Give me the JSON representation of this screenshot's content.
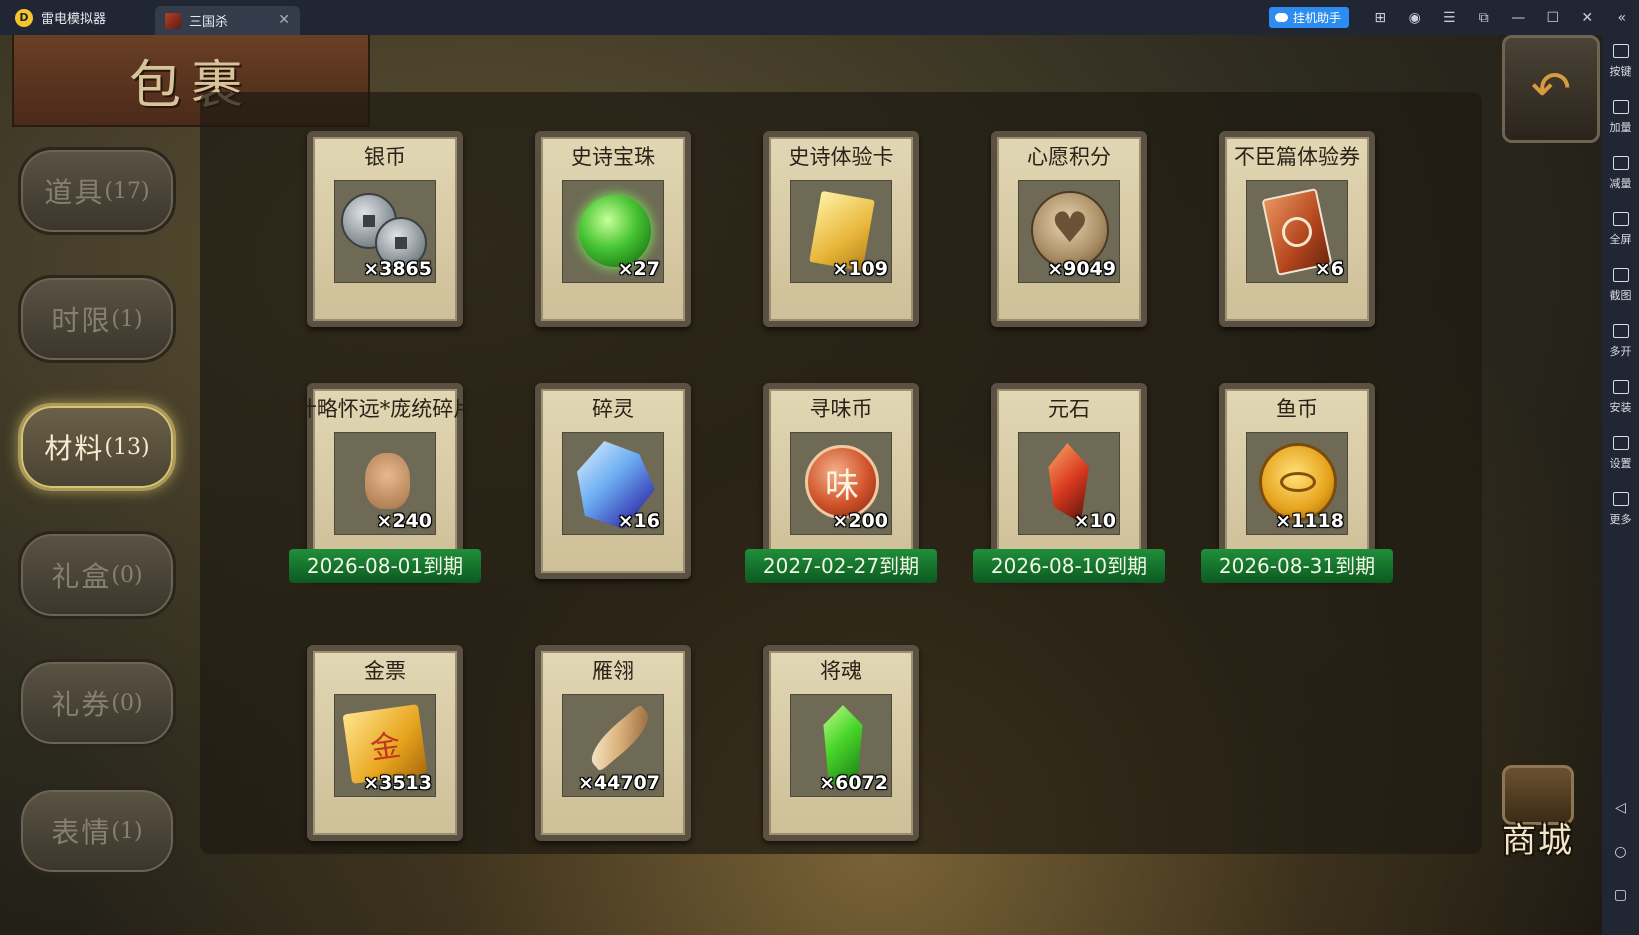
{
  "window": {
    "app_name": "雷电模拟器",
    "tab_title": "三国杀",
    "assistant_button": "挂机助手"
  },
  "emulator_toolbar": {
    "tools": [
      {
        "label": "按键",
        "icon": "keyboard-icon"
      },
      {
        "label": "加量",
        "icon": "volume-up-icon"
      },
      {
        "label": "减量",
        "icon": "volume-down-icon"
      },
      {
        "label": "全屏",
        "icon": "fullscreen-icon"
      },
      {
        "label": "截图",
        "icon": "scissors-icon"
      },
      {
        "label": "多开",
        "icon": "multi-instance-icon"
      },
      {
        "label": "安装",
        "icon": "apk-install-icon"
      },
      {
        "label": "设置",
        "icon": "gear-icon"
      },
      {
        "label": "更多",
        "icon": "more-icon"
      }
    ]
  },
  "game": {
    "title": "包裹",
    "categories": [
      {
        "name": "道具",
        "count": "(17)",
        "active": false
      },
      {
        "name": "时限",
        "count": "(1)",
        "active": false
      },
      {
        "name": "材料",
        "count": "(13)",
        "active": true
      },
      {
        "name": "礼盒",
        "count": "(0)",
        "active": false
      },
      {
        "name": "礼券",
        "count": "(0)",
        "active": false
      },
      {
        "name": "表情",
        "count": "(1)",
        "active": false
      }
    ],
    "items": [
      {
        "name": "银币",
        "qty": "×3865",
        "expiry": ""
      },
      {
        "name": "史诗宝珠",
        "qty": "×27",
        "expiry": ""
      },
      {
        "name": "史诗体验卡",
        "qty": "×109",
        "expiry": ""
      },
      {
        "name": "心愿积分",
        "qty": "×9049",
        "expiry": ""
      },
      {
        "name": "不臣篇体验券",
        "qty": "×6",
        "expiry": ""
      },
      {
        "name": "计略怀远*庞统碎片",
        "qty": "×240",
        "expiry": "2026-08-01到期"
      },
      {
        "name": "碎灵",
        "qty": "×16",
        "expiry": ""
      },
      {
        "name": "寻味币",
        "qty": "×200",
        "expiry": "2027-02-27到期"
      },
      {
        "name": "元石",
        "qty": "×10",
        "expiry": "2026-08-10到期"
      },
      {
        "name": "鱼币",
        "qty": "×1118",
        "expiry": "2026-08-31到期"
      },
      {
        "name": "金票",
        "qty": "×3513",
        "expiry": ""
      },
      {
        "name": "雁翎",
        "qty": "×44707",
        "expiry": ""
      },
      {
        "name": "将魂",
        "qty": "×6072",
        "expiry": ""
      }
    ],
    "coin_glyph": "味",
    "ticket_glyph": "金",
    "shop_label": "商城"
  }
}
